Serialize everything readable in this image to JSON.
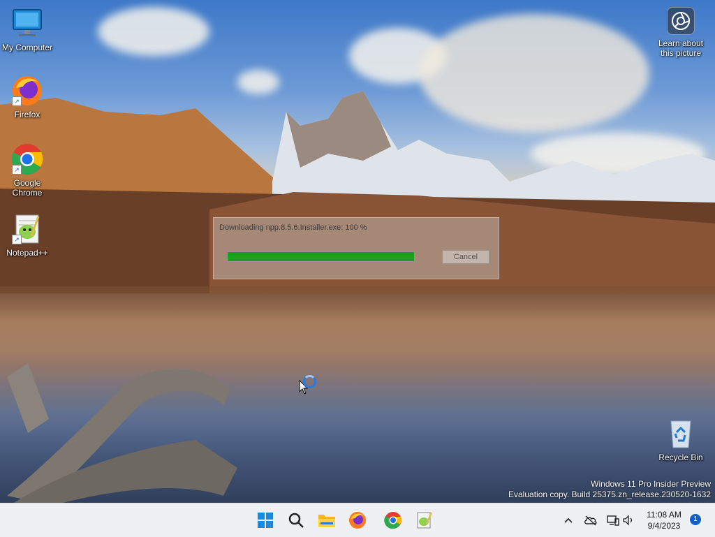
{
  "desktop": {
    "icons": [
      {
        "label": "My Computer"
      },
      {
        "label": "Firefox"
      },
      {
        "label": "Google Chrome"
      },
      {
        "label": "Notepad++"
      },
      {
        "label": "Recycle Bin"
      }
    ],
    "learn_about": "Learn about this picture"
  },
  "download_dialog": {
    "status_text": "Downloading npp.8.5.6.Installer.exe: 100 %",
    "progress_percent": 100,
    "cancel_label": "Cancel"
  },
  "watermark": {
    "line1": "Windows 11 Pro Insider Preview",
    "line2": "Evaluation copy. Build 25375.zn_release.230520-1632"
  },
  "taskbar": {
    "apps": [
      "start-icon",
      "search-icon",
      "file-explorer-icon",
      "firefox-icon",
      "chrome-icon",
      "notepadpp-icon"
    ],
    "clock_time": "11:08 AM",
    "clock_date": "9/4/2023",
    "notification_count": "1"
  },
  "colors": {
    "progress": "#1f9e1f",
    "accent": "#1060c8"
  }
}
